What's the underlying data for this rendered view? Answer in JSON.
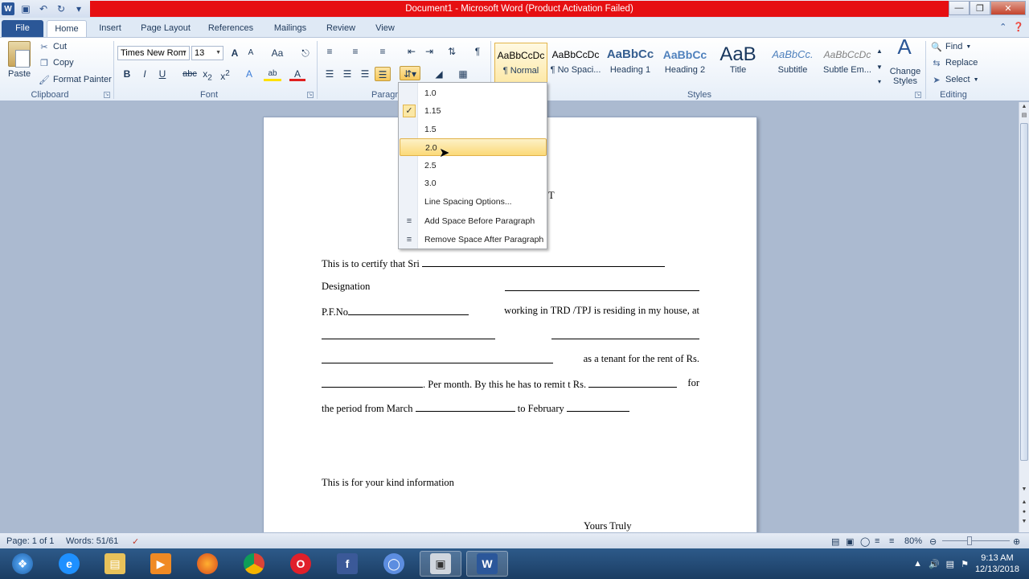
{
  "window": {
    "title": "Document1  -  Microsoft Word (Product Activation Failed)"
  },
  "tabs": [
    "File",
    "Home",
    "Insert",
    "Page Layout",
    "References",
    "Mailings",
    "Review",
    "View"
  ],
  "clipboard": {
    "paste": "Paste",
    "cut": "Cut",
    "copy": "Copy",
    "format_painter": "Format Painter",
    "label": "Clipboard"
  },
  "font": {
    "name": "Times New Rom",
    "size": "13",
    "label": "Font",
    "grow": "A",
    "shrink": "A",
    "case": "Aa",
    "bold": "B",
    "italic": "I",
    "underline": "U",
    "strike": "abc",
    "subscript": "x",
    "superscript": "x",
    "sub_mark": "2",
    "sup_mark": "2",
    "effects": "A",
    "highlight": "ab",
    "color": "A"
  },
  "paragraph": {
    "label": "Paragraph",
    "pilcrow": "¶"
  },
  "styles": {
    "label": "Styles",
    "items": [
      {
        "preview": "AaBbCcDc",
        "name": "¶ Normal"
      },
      {
        "preview": "AaBbCcDc",
        "name": "¶ No Spaci..."
      },
      {
        "preview": "AaBbCc",
        "name": "Heading 1"
      },
      {
        "preview": "AaBbCc",
        "name": "Heading 2"
      },
      {
        "preview": "AaB",
        "name": "Title"
      },
      {
        "preview": "AaBbCc.",
        "name": "Subtitle"
      },
      {
        "preview": "AaBbCcDc",
        "name": "Subtle Em..."
      }
    ],
    "change_styles": "Change Styles"
  },
  "editing": {
    "label": "Editing",
    "find": "Find",
    "replace": "Replace",
    "select": "Select"
  },
  "line_spacing_menu": {
    "items": [
      "1.0",
      "1.15",
      "1.5",
      "2.0",
      "2.5",
      "3.0"
    ],
    "checked": "1.15",
    "hovered": "2.0",
    "options": "Line Spacing Options...",
    "add_space": "Add Space Before Paragraph",
    "remove_space": "Remove Space After Paragraph"
  },
  "document": {
    "heading_fragment": "T",
    "line1": "This  is  to  certify  that  Sri",
    "designation": "Designation",
    "pfno": "P.F.No",
    "working": "working  in  TRD  /TPJ  is  residing  in  my  house,  at",
    "tenant": "as  a  tenant  for  the  rent  of    Rs.",
    "per_month": ". Per month. By this he has to remit t Rs.",
    "for": "for",
    "period": "the period from March",
    "to_feb": "to February",
    "info": "This is for your kind information",
    "yours": "Yours Truly"
  },
  "status": {
    "page": "Page: 1 of 1",
    "words": "Words: 51/61",
    "zoom": "80%"
  },
  "clock": {
    "time": "9:13 AM",
    "date": "12/13/2018"
  },
  "colors": {
    "title_bar_red": "#e60f12",
    "file_tab": "#2b5797",
    "highlight": "#fbd978",
    "taskbar": "#1b3d63"
  }
}
